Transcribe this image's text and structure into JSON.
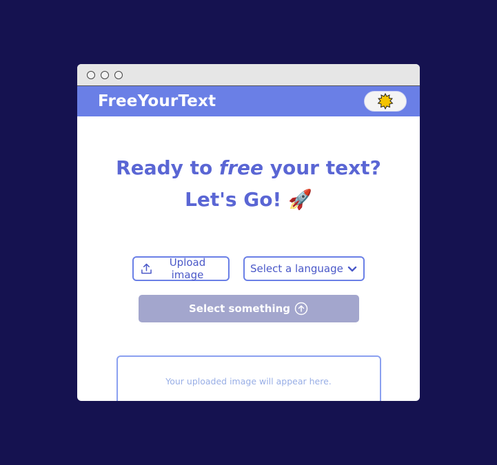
{
  "app": {
    "title": "FreeYourText"
  },
  "theme_toggle": {
    "icon": "sun-icon"
  },
  "headline": {
    "part1": "Ready to ",
    "emphasis": "free",
    "part2": " your text?",
    "line2": "Let's Go!",
    "emoji": "🚀"
  },
  "controls": {
    "upload_label": "Upload image",
    "language_placeholder": "Select a language"
  },
  "submit": {
    "label": "Select something"
  },
  "preview": {
    "placeholder": "Your uploaded image will appear here."
  },
  "colors": {
    "background": "#151250",
    "accent": "#6a7fe6",
    "heading": "#5a66d4",
    "disabled_button": "#a3a6cd"
  }
}
